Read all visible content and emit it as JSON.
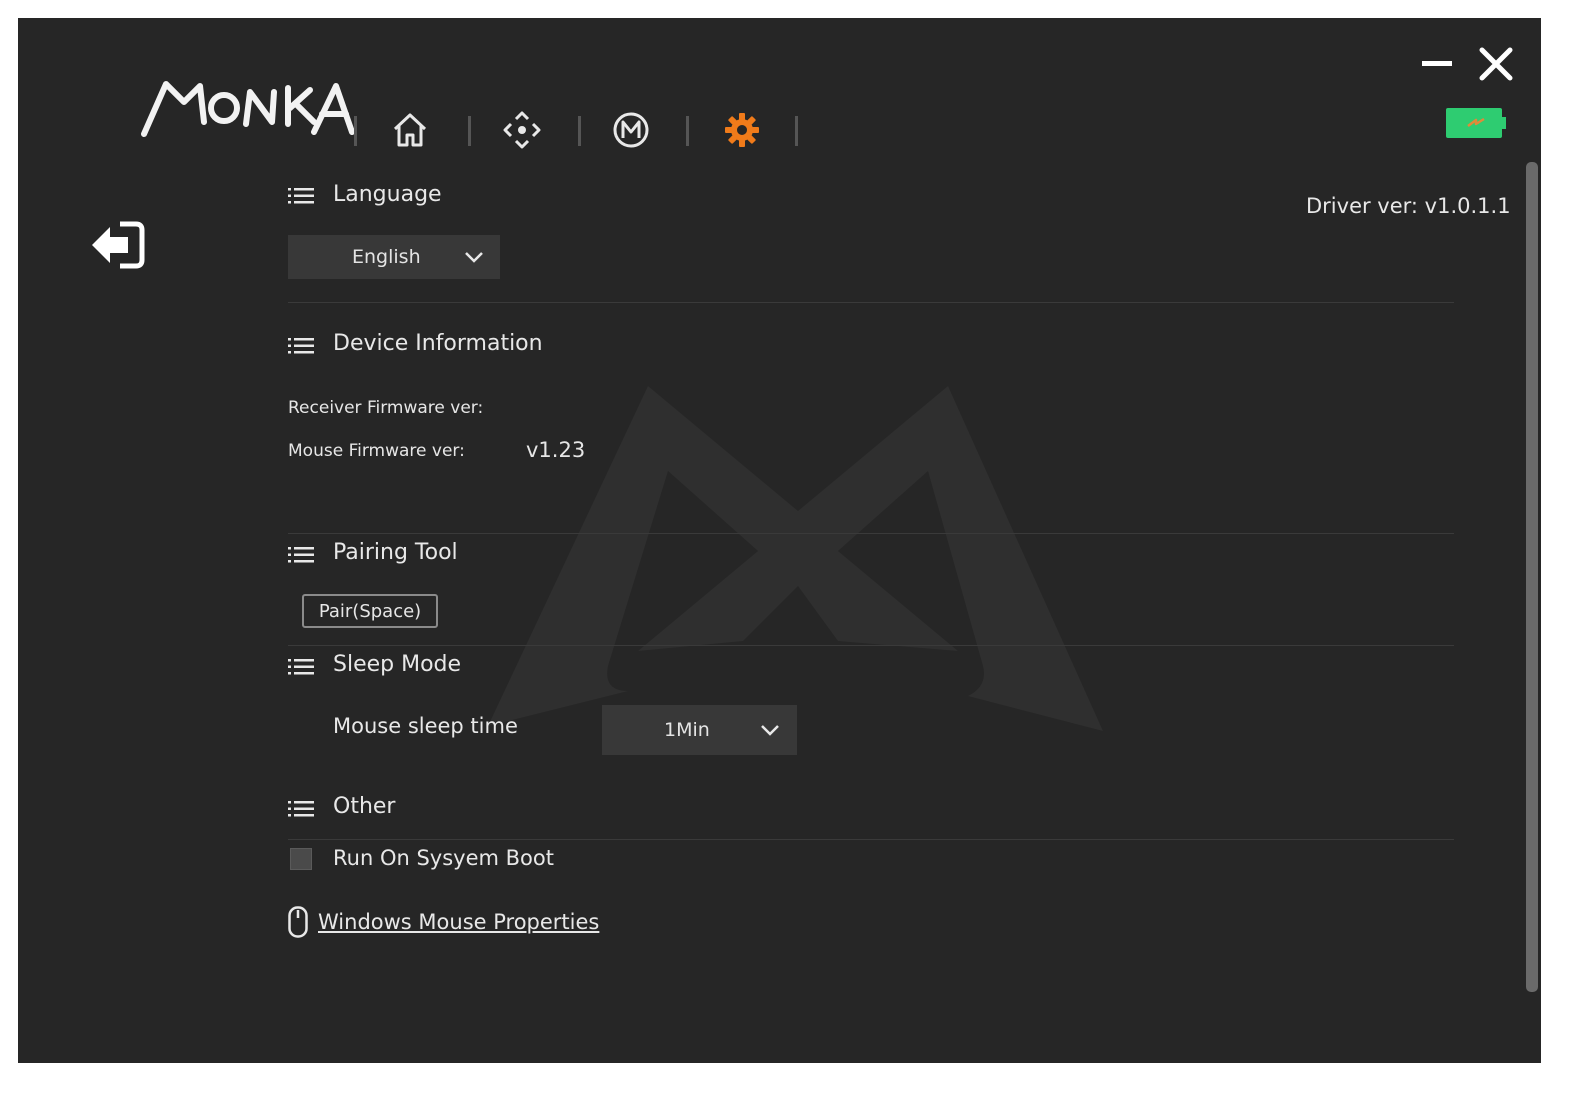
{
  "app": {
    "logo_text": "MONKA",
    "driver_version_label": "Driver ver: v1.0.1.1"
  },
  "nav": {
    "items": [
      {
        "name": "home",
        "icon": "home-icon"
      },
      {
        "name": "dpi",
        "icon": "dpi-crosshair-icon"
      },
      {
        "name": "macro",
        "icon": "macro-m-icon"
      },
      {
        "name": "settings",
        "icon": "gear-icon",
        "active": true
      }
    ],
    "active_color": "#f07b1a"
  },
  "battery": {
    "color": "#2ecc71",
    "charging": true
  },
  "sections": {
    "language": {
      "title": "Language",
      "selected": "English"
    },
    "device_info": {
      "title": "Device Information",
      "receiver_label": "Receiver Firmware ver:",
      "receiver_value": "",
      "mouse_label": "Mouse Firmware ver:",
      "mouse_value": "v1.23"
    },
    "pairing": {
      "title": "Pairing Tool",
      "button_label": "Pair(Space)"
    },
    "sleep": {
      "title": "Sleep Mode",
      "label": "Mouse sleep time",
      "selected": "1Min"
    },
    "other": {
      "title": "Other",
      "run_on_boot_label": "Run On Sysyem Boot",
      "run_on_boot_checked": false,
      "link_label": "Windows Mouse Properties"
    }
  }
}
